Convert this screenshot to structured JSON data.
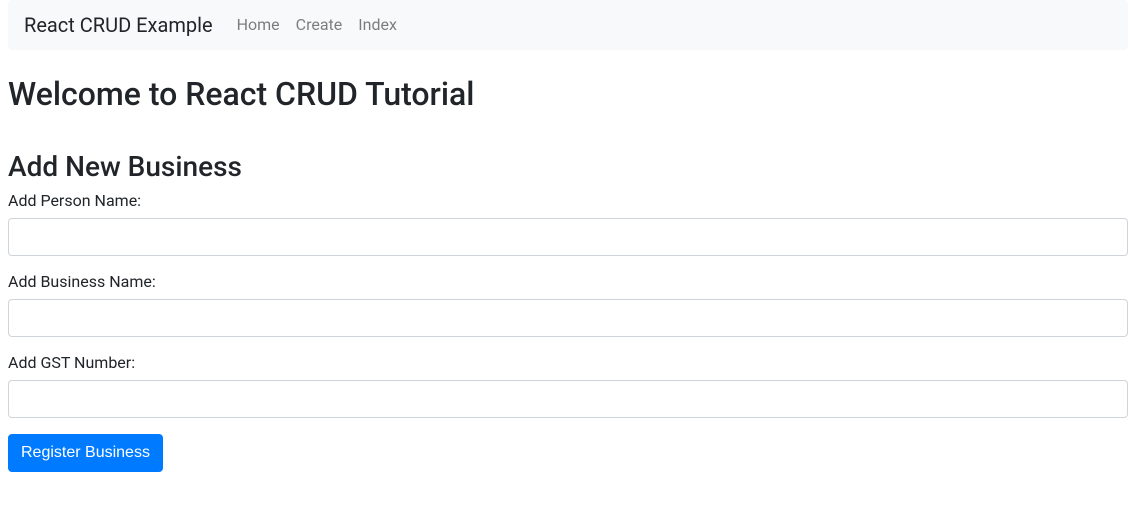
{
  "navbar": {
    "brand": "React CRUD Example",
    "links": {
      "home": "Home",
      "create": "Create",
      "index": "Index"
    }
  },
  "page": {
    "title": "Welcome to React CRUD Tutorial"
  },
  "form": {
    "title": "Add New Business",
    "person_name_label": "Add Person Name:",
    "person_name_value": "",
    "business_name_label": "Add Business Name:",
    "business_name_value": "",
    "gst_number_label": "Add GST Number:",
    "gst_number_value": "",
    "submit_label": "Register Business"
  }
}
